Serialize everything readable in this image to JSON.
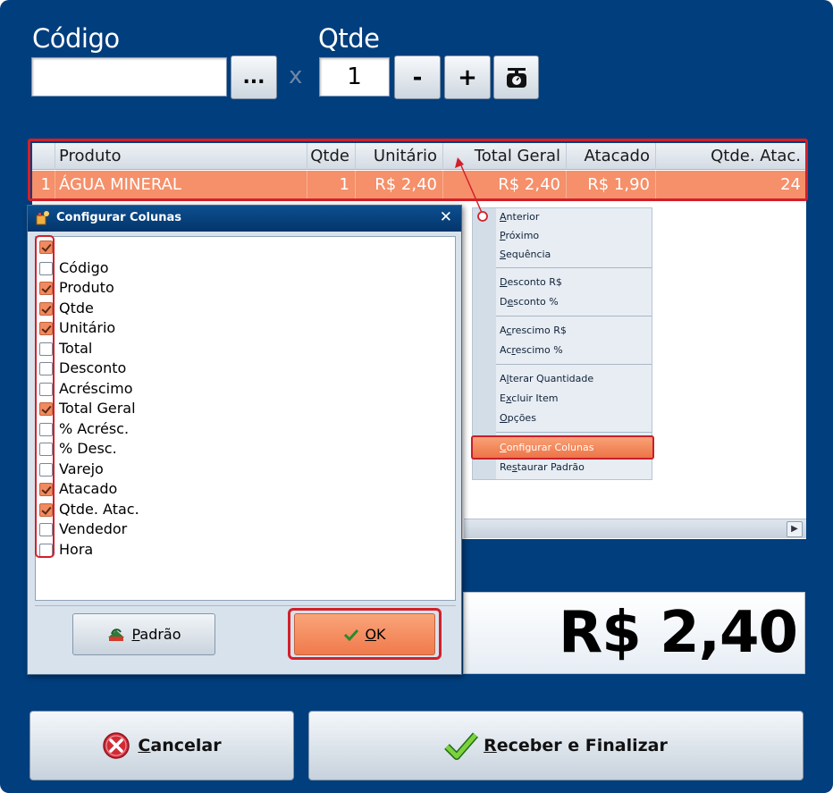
{
  "top": {
    "codigo_label": "Código",
    "codigo_value": "",
    "search_button": "...",
    "x_label": "x",
    "qtde_label": "Qtde",
    "qtde_value": "1",
    "minus_button": "-",
    "plus_button": "+"
  },
  "grid": {
    "headers": [
      "Produto",
      "Qtde",
      "Unitário",
      "Total Geral",
      "Atacado",
      "Qtde. Atac."
    ],
    "rows": [
      {
        "num": "1",
        "produto": "ÁGUA MINERAL",
        "qtde": "1",
        "unitario": "R$ 2,40",
        "total_geral": "R$ 2,40",
        "atacado": "R$ 1,90",
        "qtde_atac": "24"
      }
    ],
    "row_color": "#f5906a"
  },
  "context_menu": {
    "items": [
      {
        "label": "Anterior",
        "key": "A"
      },
      {
        "label": "Próximo",
        "key": "P"
      },
      {
        "label": "Sequência",
        "key": "S"
      },
      {
        "label": "Desconto R$",
        "key": "D"
      },
      {
        "label": "Desconto %",
        "key": "D"
      },
      {
        "label": "Acrescimo R$",
        "key": "A"
      },
      {
        "label": "Acrescimo %",
        "key": "A"
      },
      {
        "label": "Alterar Quantidade",
        "key": "l"
      },
      {
        "label": "Excluir Item",
        "key": "x"
      },
      {
        "label": "Opções",
        "key": "O"
      },
      {
        "label": "Configurar Colunas",
        "key": "C",
        "selected": true
      },
      {
        "label": "Restaurar Padrão",
        "key": "s"
      }
    ]
  },
  "total": {
    "value": "R$ 2,40"
  },
  "dialog": {
    "title": "Configurar Colunas",
    "close": "✕",
    "columns": [
      {
        "label": "",
        "checked": true
      },
      {
        "label": "Código",
        "checked": false
      },
      {
        "label": "Produto",
        "checked": true
      },
      {
        "label": "Qtde",
        "checked": true
      },
      {
        "label": "Unitário",
        "checked": true
      },
      {
        "label": "Total",
        "checked": false
      },
      {
        "label": "Desconto",
        "checked": false
      },
      {
        "label": "Acréscimo",
        "checked": false
      },
      {
        "label": "Total Geral",
        "checked": true
      },
      {
        "label": "% Acrésc.",
        "checked": false
      },
      {
        "label": "% Desc.",
        "checked": false
      },
      {
        "label": "Varejo",
        "checked": false
      },
      {
        "label": "Atacado",
        "checked": true
      },
      {
        "label": "Qtde. Atac.",
        "checked": true
      },
      {
        "label": "Vendedor",
        "checked": false
      },
      {
        "label": "Hora",
        "checked": false
      }
    ],
    "padrao_button": {
      "prefix": "",
      "underlined": "P",
      "rest": "adrão"
    },
    "ok_button": {
      "underlined": "O",
      "rest": "K"
    }
  },
  "footer": {
    "cancel_button": {
      "underlined": "C",
      "rest": "ancelar"
    },
    "finish_button": {
      "underlined": "R",
      "rest": "eceber e Finalizar"
    }
  },
  "colors": {
    "background": "#013e7d",
    "accent_orange": "#f08a60",
    "highlight_red": "#d3202a"
  }
}
